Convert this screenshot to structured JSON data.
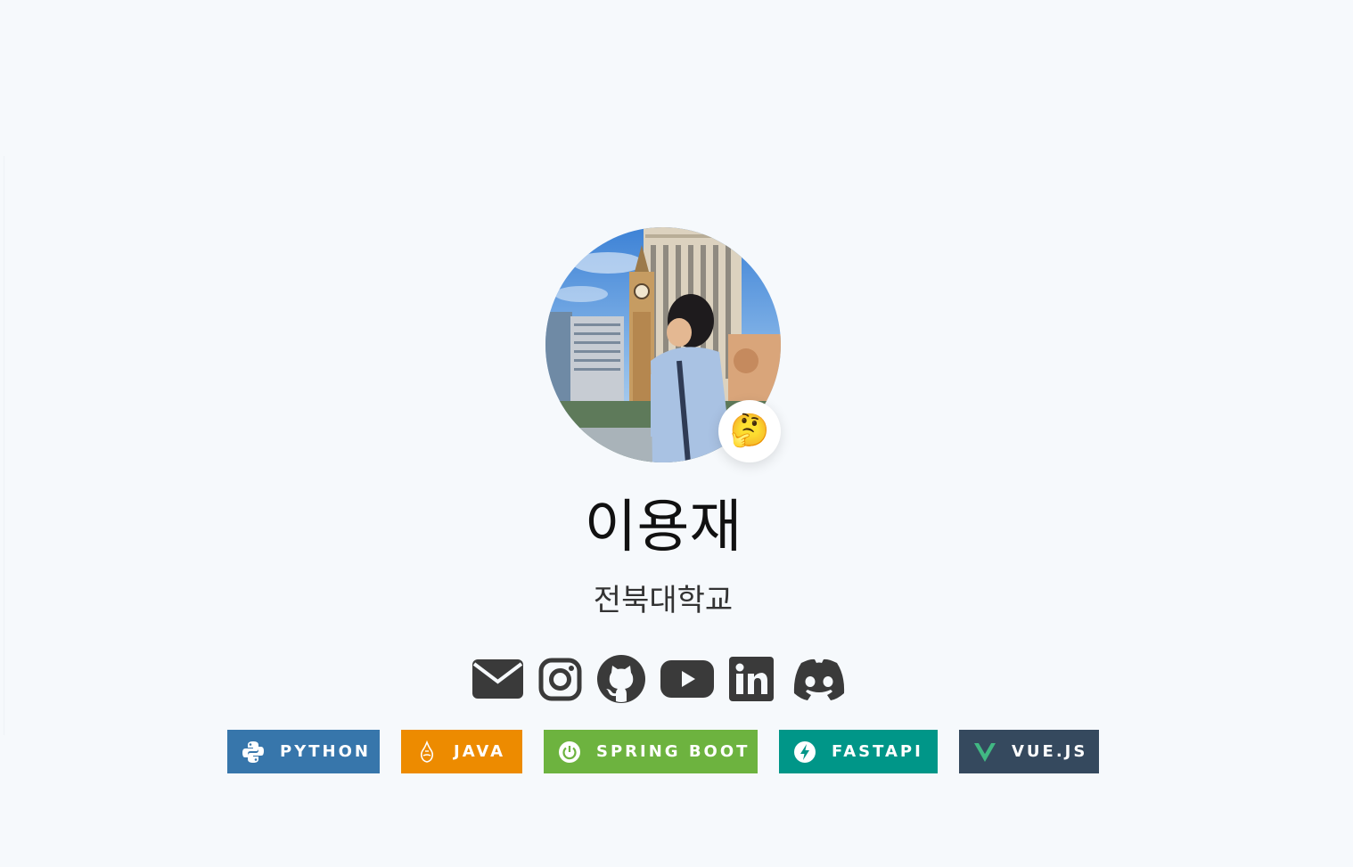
{
  "profile": {
    "name": "이용재",
    "affiliation": "전북대학교",
    "status_emoji": "🤔",
    "avatar_icon": "profile-photo"
  },
  "socials": [
    {
      "name": "email",
      "icon": "envelope-icon"
    },
    {
      "name": "instagram",
      "icon": "instagram-icon"
    },
    {
      "name": "github",
      "icon": "github-icon"
    },
    {
      "name": "youtube",
      "icon": "youtube-icon"
    },
    {
      "name": "linkedin",
      "icon": "linkedin-icon"
    },
    {
      "name": "discord",
      "icon": "discord-icon"
    }
  ],
  "badges": [
    {
      "label": "PYTHON",
      "color": "#3776ab",
      "icon": "python-icon"
    },
    {
      "label": "JAVA",
      "color": "#ed8b00",
      "icon": "java-icon"
    },
    {
      "label": "SPRING BOOT",
      "color": "#6db33f",
      "icon": "spring-boot-icon"
    },
    {
      "label": "FASTAPI",
      "color": "#009688",
      "icon": "fastapi-icon"
    },
    {
      "label": "VUE.JS",
      "color": "#35495e",
      "icon": "vuejs-icon"
    }
  ],
  "colors": {
    "background": "#f6f9fc",
    "social_icon": "#3a3a3a"
  }
}
